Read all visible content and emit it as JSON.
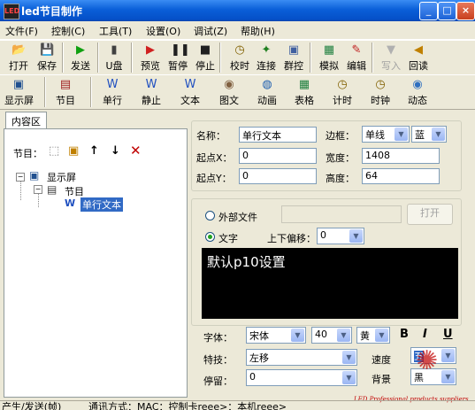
{
  "window": {
    "title": "led节目制作",
    "icon_text": "LED"
  },
  "menu": [
    "文件(F)",
    "控制(C)",
    "工具(T)",
    "设置(O)",
    "调试(Z)",
    "帮助(H)"
  ],
  "toolbar1": [
    {
      "label": "打开",
      "icon": "open-folder-icon",
      "glyph": "📂",
      "color": "#d8a000",
      "disabled": false
    },
    {
      "label": "保存",
      "icon": "save-icon",
      "glyph": "💾",
      "color": "#3050a0",
      "disabled": false
    },
    {
      "label": "发送",
      "icon": "send-icon",
      "glyph": "▶",
      "color": "#10a010",
      "disabled": false
    },
    {
      "label": "U盘",
      "icon": "usb-icon",
      "glyph": "▮",
      "color": "#404040",
      "disabled": false
    },
    {
      "label": "预览",
      "icon": "preview-icon",
      "glyph": "▶",
      "color": "#d02020",
      "disabled": false
    },
    {
      "label": "暂停",
      "icon": "pause-icon",
      "glyph": "❚❚",
      "color": "#202020",
      "disabled": false
    },
    {
      "label": "停止",
      "icon": "stop-icon",
      "glyph": "■",
      "color": "#202020",
      "disabled": false
    },
    {
      "label": "校时",
      "icon": "clock-icon",
      "glyph": "◷",
      "color": "#806000",
      "disabled": false
    },
    {
      "label": "连接",
      "icon": "connect-icon",
      "glyph": "✦",
      "color": "#208020",
      "disabled": false
    },
    {
      "label": "群控",
      "icon": "group-control-icon",
      "glyph": "▣",
      "color": "#4060a0",
      "disabled": false
    },
    {
      "label": "模拟",
      "icon": "simulate-icon",
      "glyph": "▦",
      "color": "#208040",
      "disabled": false
    },
    {
      "label": "编辑",
      "icon": "edit-icon",
      "glyph": "✎",
      "color": "#c02020",
      "disabled": false
    },
    {
      "label": "写入",
      "icon": "write-icon",
      "glyph": "▼",
      "color": "#b0b0b0",
      "disabled": true
    },
    {
      "label": "回读",
      "icon": "readback-icon",
      "glyph": "◀",
      "color": "#c08000",
      "disabled": false
    }
  ],
  "toolbar2": [
    {
      "label": "显示屏",
      "icon": "display-screen-icon",
      "glyph": "▣",
      "color": "#205090"
    },
    {
      "label": "节目",
      "icon": "program-icon",
      "glyph": "▤",
      "color": "#a02020"
    },
    {
      "label": "单行",
      "icon": "single-line-icon",
      "glyph": "W",
      "color": "#2050c0"
    },
    {
      "label": "静止",
      "icon": "static-icon",
      "glyph": "W",
      "color": "#2050c0"
    },
    {
      "label": "文本",
      "icon": "text-icon",
      "glyph": "W",
      "color": "#2050c0"
    },
    {
      "label": "图文",
      "icon": "image-text-icon",
      "glyph": "◉",
      "color": "#806040"
    },
    {
      "label": "动画",
      "icon": "animation-icon",
      "glyph": "◍",
      "color": "#2060b0"
    },
    {
      "label": "表格",
      "icon": "table-icon",
      "glyph": "▦",
      "color": "#208040"
    },
    {
      "label": "计时",
      "icon": "timer-icon",
      "glyph": "◷",
      "color": "#806000"
    },
    {
      "label": "时钟",
      "icon": "clock-icon",
      "glyph": "◷",
      "color": "#806000"
    },
    {
      "label": "动态",
      "icon": "dynamic-icon",
      "glyph": "◉",
      "color": "#3070c0"
    }
  ],
  "left_panel": {
    "tab": "内容区",
    "toolbar_label": "节目：",
    "tree": {
      "root": "显示屏",
      "program": "节目",
      "item": "单行文本"
    }
  },
  "props": {
    "name_label": "名称：",
    "name_value": "单行文本",
    "border_label": "边框：",
    "border_style": "单线",
    "border_color": "蓝",
    "x_label": "起点X：",
    "x_value": "0",
    "width_label": "宽度：",
    "width_value": "1408",
    "y_label": "起点Y：",
    "y_value": "0",
    "height_label": "高度：",
    "height_value": "64"
  },
  "content": {
    "external_file_label": "外部文件",
    "open_button": "打开",
    "text_label": "文字",
    "offset_label": "上下偏移：",
    "offset_value": "0",
    "preview_text": "默认p10设置"
  },
  "format": {
    "font_label": "字体：",
    "font_value": "宋体",
    "size_value": "40",
    "color_value": "黄",
    "bold": "B",
    "italic": "I",
    "underline": "U",
    "effect_label": "特技：",
    "effect_value": "左移",
    "speed_label": "速度",
    "speed_value": "五",
    "stay_label": "停留：",
    "stay_value": "0",
    "bg_label": "背景",
    "bg_value": "黑"
  },
  "status_bar": {
    "left": "产生/发送(帧)",
    "right": "通讯方式：MAC：控制卡reee>：本机reee>"
  },
  "watermark": "LED Professional products suppliers"
}
